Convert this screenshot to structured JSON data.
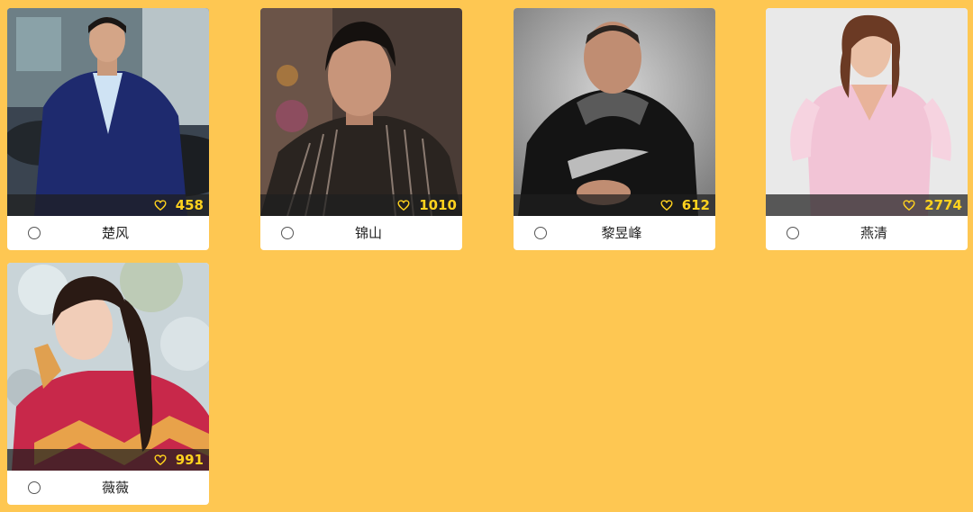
{
  "theme": {
    "background": "#FEC752",
    "vote_color": "#FFD21E",
    "card_background": "#FFFFFF"
  },
  "icons": {
    "vote": "heart-outline-icon",
    "select": "radio-circle-icon"
  },
  "contestants": [
    {
      "name": "楚风",
      "votes": "458",
      "selected": false,
      "photo": "man-in-navy-suit-by-car"
    },
    {
      "name": "锦山",
      "votes": "1010",
      "selected": false,
      "photo": "man-in-striped-shirt"
    },
    {
      "name": "黎昱峰",
      "votes": "612",
      "selected": false,
      "photo": "man-in-black-hoodie"
    },
    {
      "name": "燕清",
      "votes": "2774",
      "selected": false,
      "photo": "woman-in-pink-dress"
    },
    {
      "name": "薇薇",
      "votes": "991",
      "selected": false,
      "photo": "woman-in-red-sweater"
    }
  ]
}
